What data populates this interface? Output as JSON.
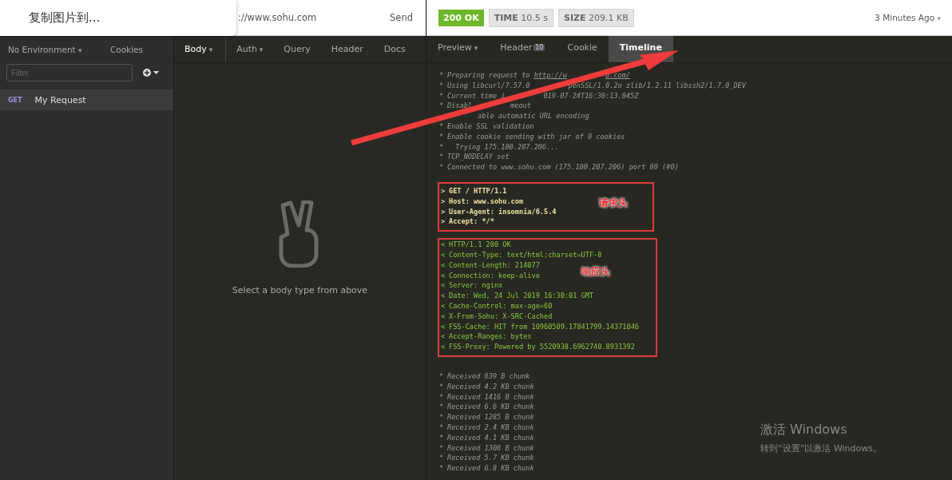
{
  "popup": {
    "label": "复制图片到..."
  },
  "url_bar": {
    "url": "://www.sohu.com",
    "send": "Send"
  },
  "response_meta": {
    "status": "200 OK",
    "time_label": "TIME",
    "time": "10.5 s",
    "size_label": "SIZE",
    "size": "209.1 KB",
    "when": "3 Minutes Ago",
    "when_caret": "▾"
  },
  "sidebar": {
    "environment": "No Environment",
    "environment_caret": "▾",
    "cookies": "Cookies",
    "filter": {
      "placeholder": "Filter"
    },
    "items": [
      {
        "method": "GET",
        "name": "My Request",
        "selected": true
      }
    ]
  },
  "request_tabs": [
    {
      "label": "Body",
      "caret": "▾",
      "selected": true
    },
    {
      "label": "Auth",
      "caret": "▾",
      "selected": false
    },
    {
      "label": "Query",
      "selected": false
    },
    {
      "label": "Header",
      "selected": false
    },
    {
      "label": "Docs",
      "selected": false
    }
  ],
  "body_hint": "Select a body type from above",
  "response_tabs": [
    {
      "label": "Preview",
      "caret": "▾",
      "selected": false
    },
    {
      "label": "Header",
      "badge": "10",
      "selected": false
    },
    {
      "label": "Cookie",
      "selected": false
    },
    {
      "label": "Timeline",
      "selected": true
    }
  ],
  "timeline": [
    {
      "kind": "info",
      "lines": [
        {
          "mark": "*",
          "text": "Preparing request to ",
          "link": "http://w",
          "link_after": "u.com/"
        },
        {
          "mark": "*",
          "text": "Using libcurl/7.57.0",
          "after": "penSSL/1.0.2o zlib/1.2.11 libssh2/1.7.0_DEV"
        },
        {
          "mark": "*",
          "text": "Current time i",
          "after": "019-07-24T16:30:13.045Z"
        },
        {
          "mark": "*",
          "text": "Disabl",
          "after": "meout"
        },
        {
          "after": "able automatic URL encoding"
        },
        {
          "mark": "*",
          "text": "Enable SSL validation"
        },
        {
          "mark": "*",
          "text": "Enable cookie sending with jar of 0 cookies"
        },
        {
          "mark": "*",
          "text": "  Trying 175.100.207.206..."
        },
        {
          "mark": "*",
          "text": "TCP_NODELAY set"
        },
        {
          "mark": "*",
          "text": "Connected to www.sohu.com (175.100.207.206) port 80 (#0)"
        }
      ]
    },
    {
      "kind": "out",
      "note": "请求头",
      "lines": [
        {
          "mark": ">",
          "text": "GET / HTTP/1.1"
        },
        {
          "mark": ">",
          "text": "Host: www.sohu.com"
        },
        {
          "mark": ">",
          "text": "User-Agent: insomnia/6.5.4"
        },
        {
          "mark": ">",
          "text": "Accept: */*"
        }
      ]
    },
    {
      "kind": "in",
      "note": "响应头",
      "lines": [
        {
          "mark": "<",
          "text": "HTTP/1.1 200 OK"
        },
        {
          "mark": "<",
          "text": "Content-Type: text/html;charset=UTF-8"
        },
        {
          "mark": "<",
          "text": "Content-Length: 214077"
        },
        {
          "mark": "<",
          "text": "Connection: keep-alive"
        },
        {
          "mark": "<",
          "text": "Server: nginx"
        },
        {
          "mark": "<",
          "text": "Date: Wed, 24 Jul 2019 16:30:01 GMT"
        },
        {
          "mark": "<",
          "text": "Cache-Control: max-age=60"
        },
        {
          "mark": "<",
          "text": "X-From-Sohu: X-SRC-Cached"
        },
        {
          "mark": "<",
          "text": "FSS-Cache: HIT from 10960509.17841799.14371046"
        },
        {
          "mark": "<",
          "text": "Accept-Ranges: bytes"
        },
        {
          "mark": "<",
          "text": "FSS-Proxy: Powered by 5520938.6962740.8931392"
        }
      ]
    },
    {
      "kind": "info",
      "lines": [
        {
          "mark": "*",
          "text": "Received 839 B chunk"
        },
        {
          "mark": "*",
          "text": "Received 4.2 KB chunk"
        },
        {
          "mark": "*",
          "text": "Received 1416 B chunk"
        },
        {
          "mark": "*",
          "text": "Received 6.6 KB chunk"
        },
        {
          "mark": "*",
          "text": "Received 1285 B chunk"
        },
        {
          "mark": "*",
          "text": "Received 2.4 KB chunk"
        },
        {
          "mark": "*",
          "text": "Received 4.1 KB chunk"
        },
        {
          "mark": "*",
          "text": "Received 1308 B chunk"
        },
        {
          "mark": "*",
          "text": "Received 5.7 KB chunk"
        },
        {
          "mark": "*",
          "text": "Received 6.8 KB chunk"
        }
      ]
    }
  ],
  "os_notice": {
    "title": "激活 Windows",
    "text": "转到“设置”以激活 Windows。"
  }
}
